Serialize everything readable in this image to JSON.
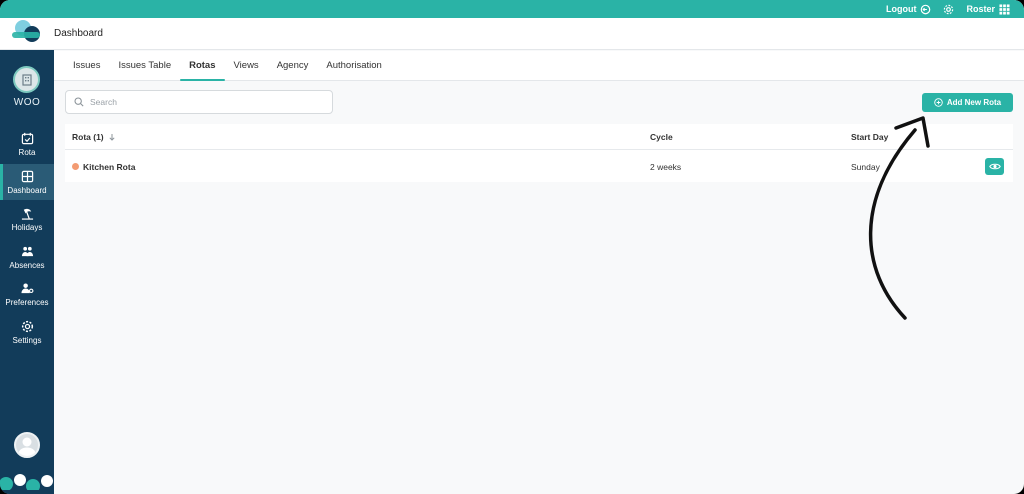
{
  "topbar": {
    "logout_label": "Logout",
    "roster_label": "Roster",
    "icons": [
      "logout-icon",
      "gear-icon",
      "grid-icon"
    ]
  },
  "header": {
    "title": "Dashboard"
  },
  "sidebar": {
    "brand": "WOO",
    "items": [
      {
        "label": "Rota",
        "icon": "calendar-check-icon"
      },
      {
        "label": "Dashboard",
        "icon": "dashboard-grid-icon",
        "active": true
      },
      {
        "label": "Holidays",
        "icon": "beach-icon"
      },
      {
        "label": "Absences",
        "icon": "users-icon"
      },
      {
        "label": "Preferences",
        "icon": "user-settings-icon"
      },
      {
        "label": "Settings",
        "icon": "gear-icon"
      }
    ]
  },
  "tabs": [
    {
      "label": "Issues"
    },
    {
      "label": "Issues Table"
    },
    {
      "label": "Rotas",
      "active": true
    },
    {
      "label": "Views"
    },
    {
      "label": "Agency"
    },
    {
      "label": "Authorisation"
    }
  ],
  "search": {
    "placeholder": "Search",
    "value": ""
  },
  "add_button": {
    "label": "Add New Rota"
  },
  "table": {
    "columns": [
      "Rota (1)",
      "Cycle",
      "Start Day"
    ],
    "rows": [
      {
        "name": "Kitchen Rota",
        "cycle": "2 weeks",
        "start_day": "Sunday",
        "status_color": "#f39b72"
      }
    ]
  },
  "colors": {
    "accent": "#2ab3a6",
    "sidebar": "#123c5a",
    "status_dot": "#f39b72"
  }
}
